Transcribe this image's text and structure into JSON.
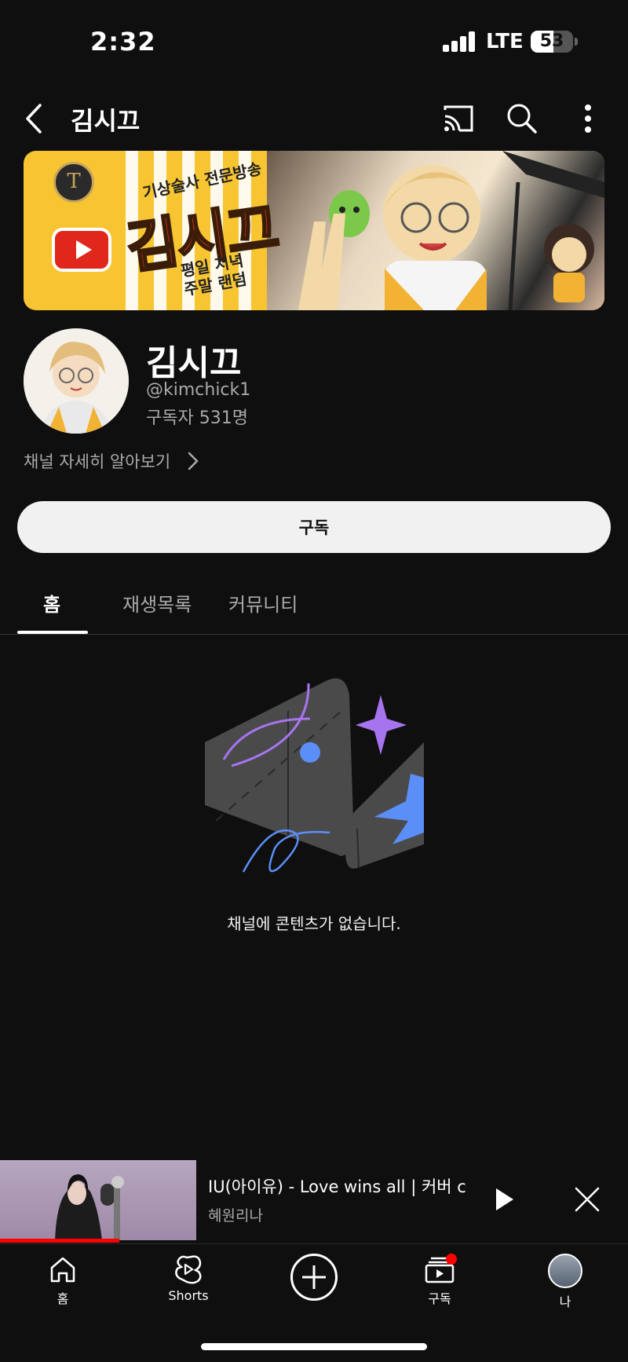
{
  "status_bar": {
    "time": "2:32",
    "network": "LTE",
    "battery": "53",
    "battery_level": 0.53
  },
  "app_bar": {
    "title": "김시끄",
    "icons": [
      "back-icon",
      "cast-icon",
      "search-icon",
      "more-vert-icon"
    ]
  },
  "banner": {
    "tagline": "기상술사 전문방송",
    "name": "김시끄",
    "schedule_line1": "평일 저녁",
    "schedule_line2": "주말 랜덤"
  },
  "channel": {
    "name": "김시끄",
    "handle": "@kimchick1",
    "subscribers": "구독자 531명",
    "more_info": "채널 자세히 알아보기"
  },
  "subscribe_label": "구독",
  "tabs": [
    {
      "label": "홈",
      "active": true
    },
    {
      "label": "재생목록",
      "active": false
    },
    {
      "label": "커뮤니티",
      "active": false
    }
  ],
  "empty_state": {
    "message": "채널에 콘텐츠가 없습니다."
  },
  "mini_player": {
    "title": "IU(아이유) - Love wins all | 커버 c...",
    "channel": "혜원리나",
    "progress": 0.19
  },
  "bottom_nav": {
    "home": "홈",
    "shorts": "Shorts",
    "subscriptions": "구독",
    "you": "나"
  },
  "colors": {
    "background": "#0f0f0f",
    "accent": "#ff0000",
    "banner_yellow": "#f7c531",
    "illustration_purple": "#a774f0",
    "illustration_blue": "#5b8ef7"
  }
}
